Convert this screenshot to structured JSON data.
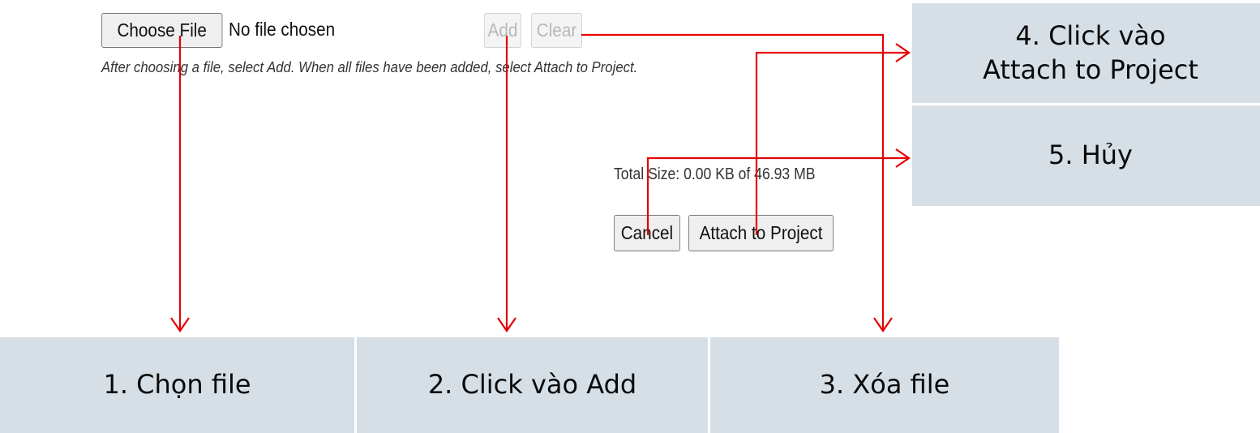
{
  "file_input": {
    "button_label": "Choose File",
    "status_text": "No file chosen"
  },
  "toolbar": {
    "add_label": "Add",
    "clear_label": "Clear"
  },
  "instructions": "After choosing a file, select Add. When all files have been added, select Attach to Project.",
  "total_size": "Total Size: 0.00 KB of 46.93 MB",
  "actions": {
    "cancel_label": "Cancel",
    "attach_label": "Attach to Project"
  },
  "callouts": {
    "step1": "1. Chọn file",
    "step2": "2. Click vào Add",
    "step3": "3. Xóa file",
    "step4_line1": "4. Click vào",
    "step4_line2": "Attach to Project",
    "step5": "5. Hủy"
  },
  "colors": {
    "callout_bg": "#d6dfe6",
    "arrow": "#e60000"
  }
}
